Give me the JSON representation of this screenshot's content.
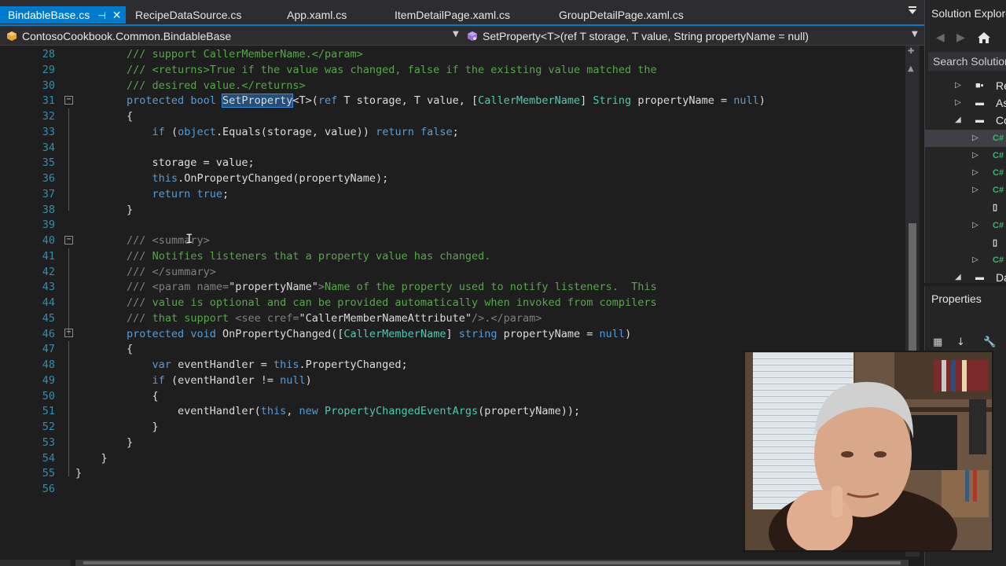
{
  "tabs": [
    {
      "label": "BindableBase.cs",
      "active": true
    },
    {
      "label": "RecipeDataSource.cs",
      "active": false
    },
    {
      "label": "App.xaml.cs",
      "active": false
    },
    {
      "label": "ItemDetailPage.xaml.cs",
      "active": false
    },
    {
      "label": "GroupDetailPage.xaml.cs",
      "active": false
    }
  ],
  "active_tab_pin": "⊣",
  "active_tab_close": "✕",
  "navbar": {
    "type_dropdown": "ContosoCookbook.Common.BindableBase",
    "member_dropdown": "SetProperty<T>(ref T storage, T value, String propertyName = null)"
  },
  "code_lines": [
    {
      "n": "28",
      "html": "        <span class=\"cm\">/// support CallerMemberName.&lt;/param&gt;</span>"
    },
    {
      "n": "29",
      "html": "        <span class=\"cm\">/// &lt;returns&gt;True if the value was changed, false if the existing value matched the</span>"
    },
    {
      "n": "30",
      "html": "        <span class=\"cm\">/// desired value.&lt;/returns&gt;</span>"
    },
    {
      "n": "31",
      "html": "        <span class=\"kw\">protected</span> <span class=\"kw\">bool</span> <span class=\"sel\">SetProperty</span>&lt;T&gt;(<span class=\"kw\">ref</span> T storage, T value, [<span class=\"ty\">CallerMemberName</span>] <span class=\"ty\">String</span> propertyName = <span class=\"kw\">null</span>)"
    },
    {
      "n": "32",
      "html": "        {"
    },
    {
      "n": "33",
      "html": "            <span class=\"kw\">if</span> (<span class=\"kw\">object</span>.Equals(storage, value)) <span class=\"kw\">return</span> <span class=\"kw\">false</span>;"
    },
    {
      "n": "34",
      "html": ""
    },
    {
      "n": "35",
      "html": "            storage = value;"
    },
    {
      "n": "36",
      "html": "            <span class=\"kw\">this</span>.OnPropertyChanged(propertyName);"
    },
    {
      "n": "37",
      "html": "            <span class=\"kw\">return</span> <span class=\"kw\">true</span>;"
    },
    {
      "n": "38",
      "html": "        }"
    },
    {
      "n": "39",
      "html": ""
    },
    {
      "n": "40",
      "html": "        <span class=\"xd\">///</span> <span class=\"xd\">&lt;summary&gt;</span>"
    },
    {
      "n": "41",
      "html": "        <span class=\"xd\">///</span> <span class=\"cm\">Notifies listeners that a property value has changed.</span>"
    },
    {
      "n": "42",
      "html": "        <span class=\"xd\">///</span> <span class=\"xd\">&lt;/summary&gt;</span>"
    },
    {
      "n": "43",
      "html": "        <span class=\"xd\">///</span> <span class=\"xd\">&lt;param name=</span>\"propertyName\"<span class=\"xd\">&gt;</span><span class=\"cm\">Name of the property used to notify listeners.  This</span>"
    },
    {
      "n": "44",
      "html": "        <span class=\"xd\">///</span> <span class=\"cm\">value is optional and can be provided automatically when invoked from compilers</span>"
    },
    {
      "n": "45",
      "html": "        <span class=\"xd\">///</span> <span class=\"cm\">that support</span> <span class=\"xd\">&lt;see cref=</span>\"CallerMemberNameAttribute\"<span class=\"xd\">/&gt;</span><span class=\"cm\">.</span><span class=\"xd\">&lt;/param&gt;</span>"
    },
    {
      "n": "46",
      "html": "        <span class=\"kw\">protected</span> <span class=\"kw\">void</span> OnPropertyChanged([<span class=\"ty\">CallerMemberName</span>] <span class=\"kw\">string</span> propertyName = <span class=\"kw\">null</span>)"
    },
    {
      "n": "47",
      "html": "        {"
    },
    {
      "n": "48",
      "html": "            <span class=\"kw\">var</span> eventHandler = <span class=\"kw\">this</span>.PropertyChanged;"
    },
    {
      "n": "49",
      "html": "            <span class=\"kw\">if</span> (eventHandler != <span class=\"kw\">null</span>)"
    },
    {
      "n": "50",
      "html": "            {"
    },
    {
      "n": "51",
      "html": "                eventHandler(<span class=\"kw\">this</span>, <span class=\"kw\">new</span> <span class=\"ty\">PropertyChangedEventArgs</span>(propertyName));"
    },
    {
      "n": "52",
      "html": "            }"
    },
    {
      "n": "53",
      "html": "        }"
    },
    {
      "n": "54",
      "html": "    }"
    },
    {
      "n": "55",
      "html": "}"
    },
    {
      "n": "56",
      "html": ""
    }
  ],
  "solution_explorer": {
    "title": "Solution Explorer",
    "search_placeholder": "Search Solution Explorer",
    "rows": [
      {
        "label": "Re",
        "icon": "reference-icon",
        "depth": 1
      },
      {
        "label": "As",
        "icon": "folder-icon",
        "depth": 1
      },
      {
        "label": "Co",
        "icon": "folder-icon",
        "depth": 1,
        "expanded": true
      },
      {
        "label": "C#",
        "icon": "csharp-file-icon",
        "depth": 2,
        "selected": true
      },
      {
        "label": "C#",
        "icon": "csharp-file-icon",
        "depth": 2
      },
      {
        "label": "C#",
        "icon": "csharp-file-icon",
        "depth": 2
      },
      {
        "label": "C#",
        "icon": "csharp-file-icon",
        "depth": 2
      },
      {
        "label": "",
        "icon": "document-icon",
        "depth": 2
      },
      {
        "label": "C#",
        "icon": "csharp-file-icon",
        "depth": 2
      },
      {
        "label": "",
        "icon": "document-icon",
        "depth": 2
      },
      {
        "label": "C#",
        "icon": "csharp-file-icon",
        "depth": 2
      },
      {
        "label": "Da",
        "icon": "folder-icon",
        "depth": 1,
        "expanded": true
      }
    ]
  },
  "properties": {
    "title": "Properties"
  }
}
